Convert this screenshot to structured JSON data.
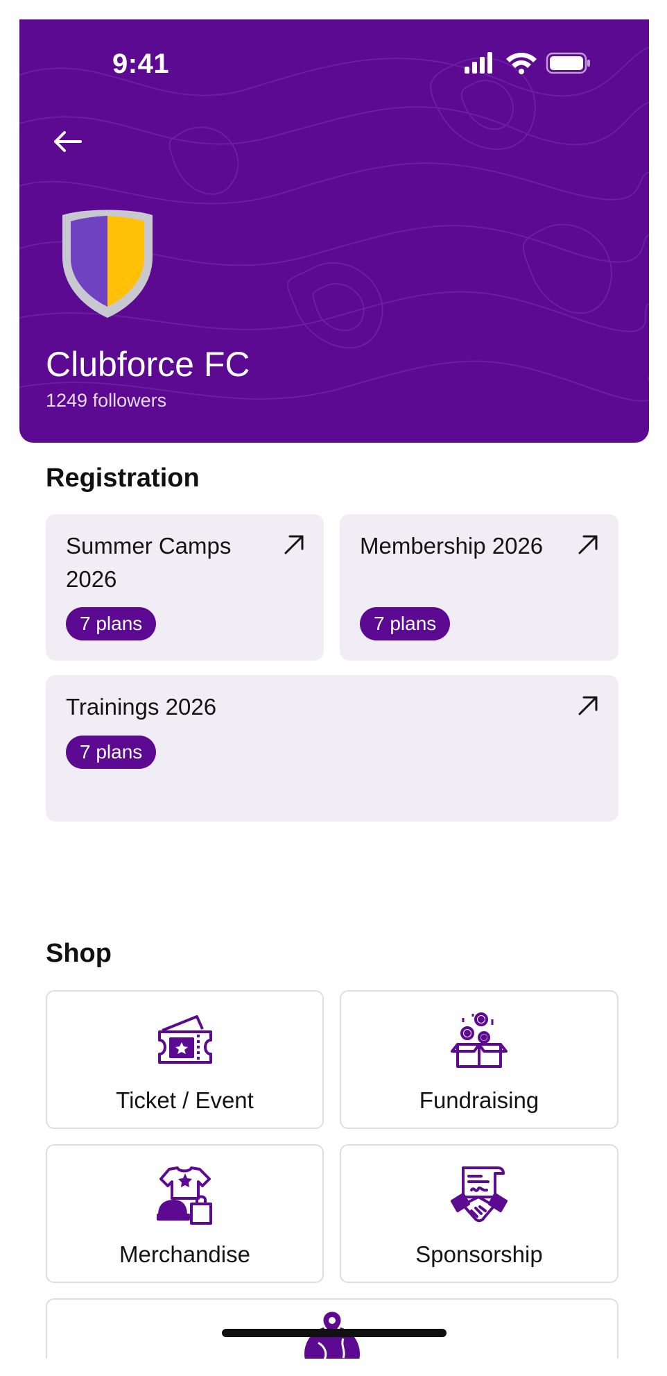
{
  "status_bar": {
    "time": "9:41"
  },
  "club": {
    "name": "Clubforce FC",
    "followers": "1249 followers"
  },
  "colors": {
    "brand": "#5b0a91",
    "accent": "#ffc107",
    "crest_left": "#6f42c1",
    "card_bg": "#f1edf4"
  },
  "registration": {
    "title": "Registration",
    "cards": [
      {
        "title": "Summer Camps 2026",
        "plans": "7 plans",
        "icon": "arrow-up-right-icon"
      },
      {
        "title": "Membership 2026",
        "plans": "7 plans",
        "icon": "arrow-up-right-icon"
      },
      {
        "title": "Trainings 2026",
        "plans": "7 plans",
        "icon": "arrow-up-right-icon"
      }
    ]
  },
  "shop": {
    "title": "Shop",
    "items": [
      {
        "label": "Ticket / Event",
        "icon": "ticket-icon"
      },
      {
        "label": "Fundraising",
        "icon": "donation-box-icon"
      },
      {
        "label": "Merchandise",
        "icon": "merchandise-icon"
      },
      {
        "label": "Sponsorship",
        "icon": "handshake-icon"
      },
      {
        "label": "",
        "icon": "globe-pin-icon"
      }
    ]
  }
}
